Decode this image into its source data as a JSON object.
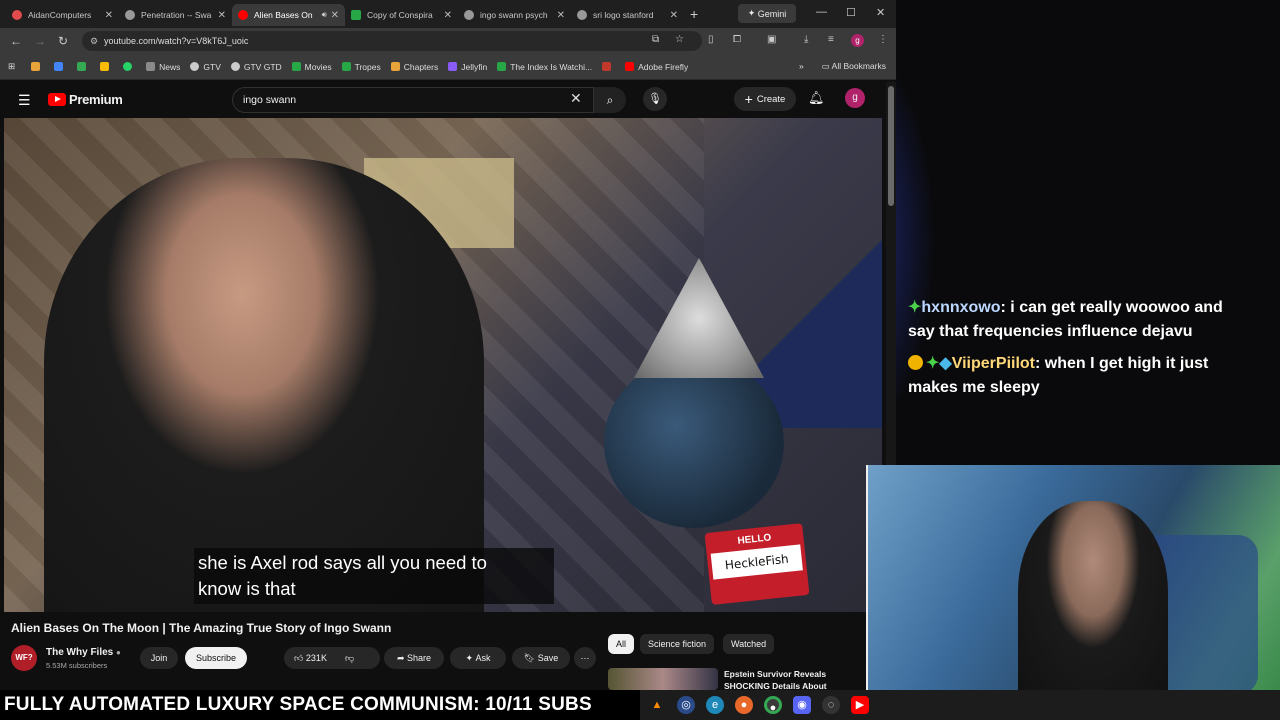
{
  "browser": {
    "tabs": [
      {
        "label": "AidanComputers",
        "color": "#e14b4b",
        "active": false
      },
      {
        "label": "Penetration -- Swa",
        "color": "#999999",
        "active": false
      },
      {
        "label": "Alien Bases On",
        "color": "#ff0000",
        "active": true
      },
      {
        "label": "Copy of Conspira",
        "color": "#27a745",
        "active": false
      },
      {
        "label": "ingo swann psych",
        "color": "#999999",
        "active": false
      },
      {
        "label": "sri logo stanford",
        "color": "#999999",
        "active": false
      }
    ],
    "gemini_label": "Gemini",
    "url": "youtube.com/watch?v=V8kT6J_uoic",
    "bookmarks": [
      {
        "label": "",
        "color": "#e8a33b"
      },
      {
        "label": "",
        "color": "#4285f4"
      },
      {
        "label": "",
        "color": "#34a853"
      },
      {
        "label": "",
        "color": "#fbbc05"
      },
      {
        "label": "",
        "color": "#25d366"
      },
      {
        "label": "News",
        "color": "#8a8a8a"
      },
      {
        "label": "GTV",
        "color": "#cccccc"
      },
      {
        "label": "GTV GTD",
        "color": "#cccccc"
      },
      {
        "label": "Movies",
        "color": "#27a745"
      },
      {
        "label": "Tropes",
        "color": "#27a745"
      },
      {
        "label": "Chapters",
        "color": "#e8a33b"
      },
      {
        "label": "Jellyfin",
        "color": "#8a5cf6"
      },
      {
        "label": "The Index Is Watchi...",
        "color": "#27a745"
      },
      {
        "label": "",
        "color": "#c0392b"
      },
      {
        "label": "Adobe Firefly",
        "color": "#ff0000"
      }
    ],
    "all_bookmarks": "All Bookmarks"
  },
  "youtube": {
    "brand": "Premium",
    "search_value": "ingo swann",
    "create_label": "Create",
    "avatar_letter": "g",
    "caption_line1": "she is Axel rod says all you need to",
    "caption_line2": "know is that",
    "sign_hello": "HELLO",
    "sign_name": "HeckleFish",
    "video_title": "Alien Bases On The Moon | The Amazing True Story of Ingo Swann",
    "channel_name": "The Why Files",
    "channel_subs": "5.53M subscribers",
    "channel_avatar_text": "WF?",
    "join_label": "Join",
    "subscribe_label": "Subscribe",
    "likes": "231K",
    "share_label": "Share",
    "ask_label": "Ask",
    "save_label": "Save",
    "chips": [
      "All",
      "Science fiction",
      "Watched"
    ],
    "rec_title": "Epstein Survivor Reveals SHOCKING Details About"
  },
  "chat": [
    {
      "user": "hxnnxowo",
      "text": "i can get really woowoo and say that frequencies influence dejavu"
    },
    {
      "user": "ViiperPiilot",
      "text": "when I get high it just makes me sleepy"
    }
  ],
  "ticker": "FULLY AUTOMATED LUXURY SPACE COMMUNISM: 10/11 SUBS"
}
